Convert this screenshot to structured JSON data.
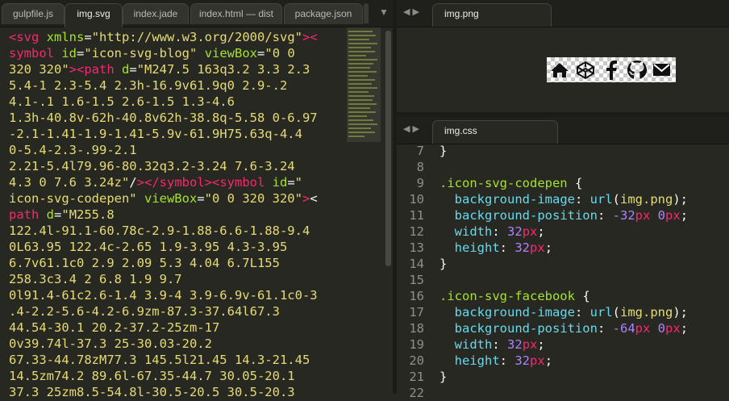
{
  "left_tabs": [
    "gulpfile.js",
    "img.svg",
    "index.jade",
    "index.html — dist",
    "package.json"
  ],
  "left_active_tab": "img.svg",
  "tab_arrows": "◀ ▶",
  "dropdown_arrow": "▼",
  "right_top_tab": "img.png",
  "right_bottom_tab": "img.css",
  "svg_lines": [
    [
      [
        "tag",
        "<"
      ],
      [
        "tag",
        "svg"
      ],
      [
        "plain",
        " "
      ],
      [
        "attr",
        "xmlns"
      ],
      [
        "plain",
        "="
      ],
      [
        "str",
        "\"http://www.w3.org/2000/svg\""
      ],
      [
        "tag",
        "><"
      ]
    ],
    [
      [
        "tag",
        "symbol"
      ],
      [
        "plain",
        " "
      ],
      [
        "attr",
        "id"
      ],
      [
        "plain",
        "="
      ],
      [
        "str",
        "\"icon-svg-blog\""
      ],
      [
        "plain",
        " "
      ],
      [
        "attr",
        "viewBox"
      ],
      [
        "plain",
        "="
      ],
      [
        "str",
        "\"0 0"
      ]
    ],
    [
      [
        "str",
        "320 320\""
      ],
      [
        "tag",
        "><path"
      ],
      [
        "plain",
        " "
      ],
      [
        "attr",
        "d"
      ],
      [
        "plain",
        "="
      ],
      [
        "str",
        "\"M247.5 163q3.2 3.3 2.3"
      ]
    ],
    [
      [
        "str",
        "5.4-1 2.3-5.4 2.3h-16.9v61.9q0 2.9-.2"
      ]
    ],
    [
      [
        "str",
        "4.1-.1 1.6-1.5 2.6-1.5 1.3-4.6"
      ]
    ],
    [
      [
        "str",
        "1.3h-40.8v-62h-40.8v62h-38.8q-5.58 0-6.97"
      ]
    ],
    [
      [
        "str",
        "-2.1-1.41-1.9-1.41-5.9v-61.9H75.63q-4.4"
      ]
    ],
    [
      [
        "str",
        "0-5.4-2.3-.99-2.1"
      ]
    ],
    [
      [
        "str",
        "2.21-5.4l79.96-80.32q3.2-3.24 7.6-3.24"
      ]
    ],
    [
      [
        "str",
        "4.3 0 7.6 3.24z\""
      ],
      [
        "plain",
        "/"
      ],
      [
        "tag",
        "></"
      ],
      [
        "tag",
        "symbol"
      ],
      [
        "tag",
        "><symbol"
      ],
      [
        "plain",
        " "
      ],
      [
        "attr",
        "id"
      ],
      [
        "plain",
        "="
      ],
      [
        "str",
        "\""
      ]
    ],
    [
      [
        "str",
        "icon-svg-codepen\""
      ],
      [
        "plain",
        " "
      ],
      [
        "attr",
        "viewBox"
      ],
      [
        "plain",
        "="
      ],
      [
        "str",
        "\"0 0 320 320\""
      ],
      [
        "tag",
        ">"
      ],
      [
        "plain",
        "<"
      ]
    ],
    [
      [
        "tag",
        "path"
      ],
      [
        "plain",
        " "
      ],
      [
        "attr",
        "d"
      ],
      [
        "plain",
        "="
      ],
      [
        "str",
        "\"M255.8"
      ]
    ],
    [
      [
        "str",
        "122.4l-91.1-60.78c-2.9-1.88-6.6-1.88-9.4"
      ]
    ],
    [
      [
        "str",
        "0L63.95 122.4c-2.65 1.9-3.95 4.3-3.95"
      ]
    ],
    [
      [
        "str",
        "6.7v61.1c0 2.9 2.09 5.3 4.04 6.7L155"
      ]
    ],
    [
      [
        "str",
        "258.3c3.4 2 6.8 1.9 9.7"
      ]
    ],
    [
      [
        "str",
        "0l91.4-61c2.6-1.4 3.9-4 3.9-6.9v-61.1c0-3"
      ]
    ],
    [
      [
        "str",
        ".4-2.2-5.6-4.2-6.9zm-87.3-37.64l67.3"
      ]
    ],
    [
      [
        "str",
        "44.54-30.1 20.2-37.2-25zm-17"
      ]
    ],
    [
      [
        "str",
        "0v39.74l-37.3 25-30.03-20.2"
      ]
    ],
    [
      [
        "str",
        "67.33-44.78zM77.3 145.5l21.45 14.3-21.45"
      ]
    ],
    [
      [
        "str",
        "14.5zm74.2 89.6l-67.35-44.7 30.05-20.1"
      ]
    ],
    [
      [
        "str",
        "37.3 25zm8.5-54.8l-30.5-20.5 30.5-20.3"
      ]
    ]
  ],
  "css_line_numbers": [
    "7",
    "8",
    "9",
    "10",
    "11",
    "12",
    "13",
    "14",
    "15",
    "16",
    "17",
    "18",
    "19",
    "20",
    "21",
    "22"
  ],
  "css_lines": [
    [
      [
        "plain",
        "}"
      ]
    ],
    [],
    [
      [
        "sel",
        ".icon-svg-codepen"
      ],
      [
        "plain",
        " {"
      ]
    ],
    [
      [
        "plain",
        "  "
      ],
      [
        "prop",
        "background-image"
      ],
      [
        "plain",
        ": "
      ],
      [
        "fn",
        "url"
      ],
      [
        "plain",
        "("
      ],
      [
        "arg",
        "img.png"
      ],
      [
        "plain",
        ");"
      ]
    ],
    [
      [
        "plain",
        "  "
      ],
      [
        "prop",
        "background-position"
      ],
      [
        "plain",
        ": "
      ],
      [
        "num",
        "-32"
      ],
      [
        "unit",
        "px"
      ],
      [
        "plain",
        " "
      ],
      [
        "num",
        "0"
      ],
      [
        "unit",
        "px"
      ],
      [
        "plain",
        ";"
      ]
    ],
    [
      [
        "plain",
        "  "
      ],
      [
        "prop",
        "width"
      ],
      [
        "plain",
        ": "
      ],
      [
        "num",
        "32"
      ],
      [
        "unit",
        "px"
      ],
      [
        "plain",
        ";"
      ]
    ],
    [
      [
        "plain",
        "  "
      ],
      [
        "prop",
        "height"
      ],
      [
        "plain",
        ": "
      ],
      [
        "num",
        "32"
      ],
      [
        "unit",
        "px"
      ],
      [
        "plain",
        ";"
      ]
    ],
    [
      [
        "plain",
        "}"
      ]
    ],
    [],
    [
      [
        "sel",
        ".icon-svg-facebook"
      ],
      [
        "plain",
        " {"
      ]
    ],
    [
      [
        "plain",
        "  "
      ],
      [
        "prop",
        "background-image"
      ],
      [
        "plain",
        ": "
      ],
      [
        "fn",
        "url"
      ],
      [
        "plain",
        "("
      ],
      [
        "arg",
        "img.png"
      ],
      [
        "plain",
        ");"
      ]
    ],
    [
      [
        "plain",
        "  "
      ],
      [
        "prop",
        "background-position"
      ],
      [
        "plain",
        ": "
      ],
      [
        "num",
        "-64"
      ],
      [
        "unit",
        "px"
      ],
      [
        "plain",
        " "
      ],
      [
        "num",
        "0"
      ],
      [
        "unit",
        "px"
      ],
      [
        "plain",
        ";"
      ]
    ],
    [
      [
        "plain",
        "  "
      ],
      [
        "prop",
        "width"
      ],
      [
        "plain",
        ": "
      ],
      [
        "num",
        "32"
      ],
      [
        "unit",
        "px"
      ],
      [
        "plain",
        ";"
      ]
    ],
    [
      [
        "plain",
        "  "
      ],
      [
        "prop",
        "height"
      ],
      [
        "plain",
        ": "
      ],
      [
        "num",
        "32"
      ],
      [
        "unit",
        "px"
      ],
      [
        "plain",
        ";"
      ]
    ],
    [
      [
        "plain",
        "}"
      ]
    ],
    []
  ],
  "sprite_icons": [
    "home-icon",
    "codepen-icon",
    "facebook-icon",
    "github-icon",
    "mail-icon"
  ]
}
